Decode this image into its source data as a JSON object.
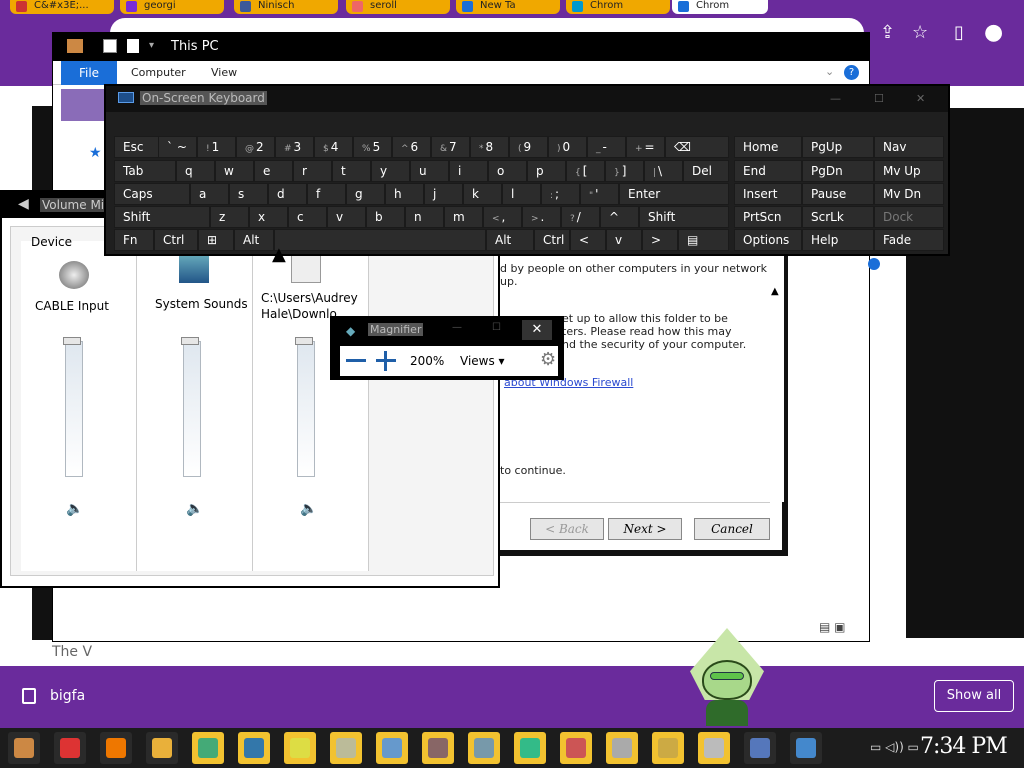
{
  "browser": {
    "tabs": [
      {
        "label": "C&#x3E;..."
      },
      {
        "label": "georgi"
      },
      {
        "label": "Ninisch"
      },
      {
        "label": "seroll"
      },
      {
        "label": "New Ta"
      },
      {
        "label": "Chrom"
      },
      {
        "label": "Chrom"
      }
    ],
    "active_tab": "Chrom",
    "bottom_file": "bigfa",
    "show_all": "Show all",
    "page_text_fragment": "The V"
  },
  "explorer": {
    "title": "This PC",
    "ribbon_file": "File",
    "ribbon_tabs": [
      "Computer",
      "View"
    ]
  },
  "wizard": {
    "text1": "d by people on other computers in your network",
    "text1b": "up.",
    "text2a": "et up to allow this folder to be",
    "text2b": "ters. Please read how this may",
    "text2c": "nd the security of your computer.",
    "link": "about Windows Firewall",
    "text3": "to continue.",
    "back": "< Back",
    "next": "Next >",
    "cancel": "Cancel"
  },
  "volume_mixer": {
    "title": "Volume Mix",
    "device_label": "Device",
    "channels": [
      {
        "name": "CABLE Input",
        "level": 1.0
      },
      {
        "name": "System Sounds",
        "level": 1.0
      },
      {
        "name_line1": "C:\\Users\\Audrey",
        "name_line2": "Hale\\Downlo",
        "level": 1.0
      }
    ]
  },
  "osk": {
    "title": "On-Screen Keyboard",
    "rows": [
      [
        {
          "l": "Esc"
        },
        {
          "l": "` ~",
          "s": ""
        },
        {
          "l": "1",
          "s": "!"
        },
        {
          "l": "2",
          "s": "@"
        },
        {
          "l": "3",
          "s": "#"
        },
        {
          "l": "4",
          "s": "$"
        },
        {
          "l": "5",
          "s": "%"
        },
        {
          "l": "6",
          "s": "^"
        },
        {
          "l": "7",
          "s": "&"
        },
        {
          "l": "8",
          "s": "*"
        },
        {
          "l": "9",
          "s": "("
        },
        {
          "l": "0",
          "s": ")"
        },
        {
          "l": "-",
          "s": "_"
        },
        {
          "l": "=",
          "s": "+"
        },
        {
          "l": "⌫"
        }
      ],
      [
        {
          "l": "Tab"
        },
        {
          "l": "q"
        },
        {
          "l": "w"
        },
        {
          "l": "e"
        },
        {
          "l": "r"
        },
        {
          "l": "t"
        },
        {
          "l": "y"
        },
        {
          "l": "u"
        },
        {
          "l": "i"
        },
        {
          "l": "o"
        },
        {
          "l": "p"
        },
        {
          "l": "[",
          "s": "{"
        },
        {
          "l": "]",
          "s": "}"
        },
        {
          "l": "\\",
          "s": "|"
        },
        {
          "l": "Del"
        }
      ],
      [
        {
          "l": "Caps"
        },
        {
          "l": "a"
        },
        {
          "l": "s"
        },
        {
          "l": "d"
        },
        {
          "l": "f"
        },
        {
          "l": "g"
        },
        {
          "l": "h"
        },
        {
          "l": "j"
        },
        {
          "l": "k"
        },
        {
          "l": "l"
        },
        {
          "l": ";",
          "s": ":"
        },
        {
          "l": "'",
          "s": "\""
        },
        {
          "l": "Enter"
        }
      ],
      [
        {
          "l": "Shift"
        },
        {
          "l": "z"
        },
        {
          "l": "x"
        },
        {
          "l": "c"
        },
        {
          "l": "v"
        },
        {
          "l": "b"
        },
        {
          "l": "n"
        },
        {
          "l": "m"
        },
        {
          "l": ",",
          "s": "<"
        },
        {
          "l": ".",
          "s": ">"
        },
        {
          "l": "/",
          "s": "?"
        },
        {
          "l": "^"
        },
        {
          "l": "Shift"
        }
      ],
      [
        {
          "l": "Fn"
        },
        {
          "l": "Ctrl"
        },
        {
          "l": "⊞"
        },
        {
          "l": "Alt"
        },
        {
          "l": ""
        },
        {
          "l": "Alt"
        },
        {
          "l": "Ctrl"
        },
        {
          "l": "<"
        },
        {
          "l": "v"
        },
        {
          "l": ">"
        },
        {
          "l": "▤"
        }
      ]
    ],
    "nav_keys": [
      [
        "Home",
        "PgUp",
        "Nav"
      ],
      [
        "End",
        "PgDn",
        "Mv Up"
      ],
      [
        "Insert",
        "Pause",
        "Mv Dn"
      ],
      [
        "PrtScn",
        "ScrLk",
        "Dock"
      ],
      [
        "Options",
        "Help",
        "Fade"
      ]
    ]
  },
  "magnifier": {
    "title": "Magnifier",
    "zoom": "200%",
    "views": "Views ▾"
  },
  "taskbar": {
    "clock": "7:34 PM"
  }
}
